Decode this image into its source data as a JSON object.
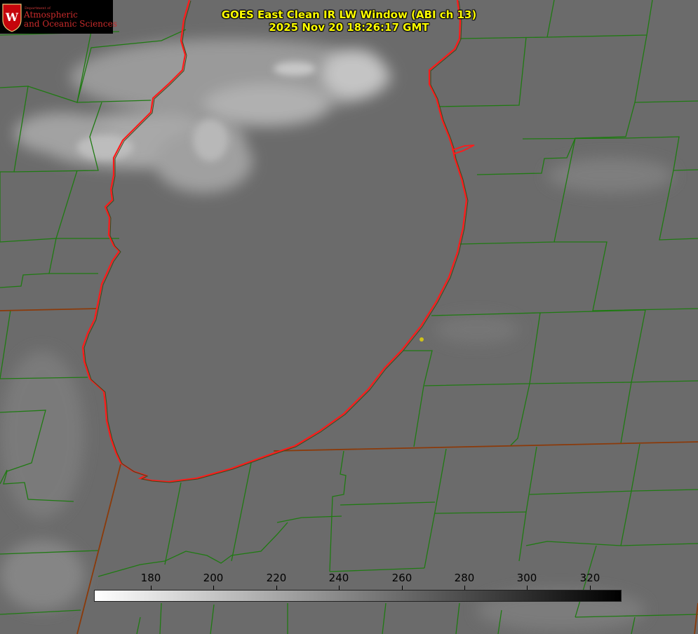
{
  "logo": {
    "department_text": "Department of",
    "line1": "Atmospheric",
    "line2": "and Oceanic Sciences",
    "seal_letter": "W",
    "seal_color": "#c5050c"
  },
  "title": {
    "line1": "GOES East Clean IR LW Window (ABI ch 13)",
    "line2": "2025 Nov 20 18:26:17 GMT"
  },
  "colorbar": {
    "ticks": [
      "180",
      "200",
      "220",
      "240",
      "260",
      "280",
      "300",
      "320"
    ],
    "gradient": [
      "#ffffff",
      "#000000"
    ]
  },
  "colors": {
    "title_text": "#ffff00",
    "county_lines": "#1f7a12",
    "state_lines": "#8b3a0a",
    "lake_shoreline": "#ff1a1a",
    "marker": "#cfc21a"
  }
}
